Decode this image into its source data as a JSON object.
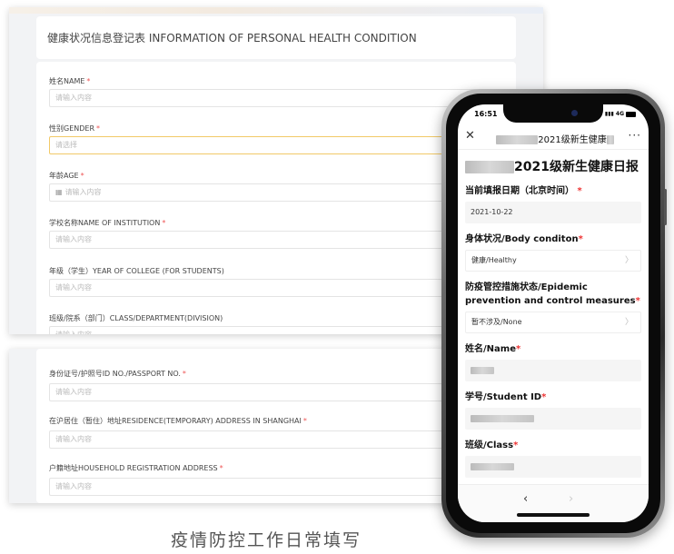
{
  "desktop_form": {
    "title": "健康状况信息登记表 INFORMATION OF PERSONAL HEALTH CONDITION",
    "fields_top": [
      {
        "label": "姓名NAME",
        "placeholder": "请输入内容"
      },
      {
        "label": "性别GENDER",
        "placeholder": "请选择"
      },
      {
        "label": "年龄AGE",
        "placeholder": "请输入内容"
      },
      {
        "label": "学校名称NAME OF INSTITUTION",
        "placeholder": "请输入内容"
      },
      {
        "label": "年级（学生）YEAR OF COLLEGE (FOR STUDENTS)",
        "placeholder": "请输入内容"
      },
      {
        "label": "班级/院系（部门）CLASS/DEPARTMENT(DIVISION)",
        "placeholder": "请输入内容"
      }
    ],
    "fields_bottom": [
      {
        "label": "身份证号/护照号ID NO./PASSPORT NO.",
        "placeholder": "请输入内容"
      },
      {
        "label": "在沪居住（暂住）地址RESIDENCE(TEMPORARY) ADDRESS IN SHANGHAI",
        "placeholder": "请输入内容"
      },
      {
        "label": "户籍地址HOUSEHOLD REGISTRATION ADDRESS",
        "placeholder": "请输入内容"
      }
    ],
    "required_mark": "*"
  },
  "phone": {
    "status_time": "16:51",
    "status_signal": "4G",
    "nav_title": "2021级新生健康",
    "page_title": "2021级新生健康日报",
    "questions": [
      {
        "label": "当前填报日期（北京时间）",
        "value": "2021-10-22"
      },
      {
        "label": "身体状况/Body conditon",
        "value": "健康/Healthy"
      },
      {
        "label": "防疫管控措施状态/Epidemic prevention and control measures",
        "value": "暂不涉及/None"
      },
      {
        "label": "姓名/Name",
        "value": ""
      },
      {
        "label": "学号/Student ID",
        "value": ""
      },
      {
        "label": "班级/Class",
        "value": ""
      }
    ],
    "required_mark": "*"
  },
  "caption": "疫情防控工作日常填写",
  "icons": {
    "close": "close-icon",
    "more": "more-icon",
    "chevron": "chevron-right-icon",
    "back": "back-arrow-icon",
    "forward": "forward-arrow-icon",
    "calendar": "calendar-icon"
  }
}
